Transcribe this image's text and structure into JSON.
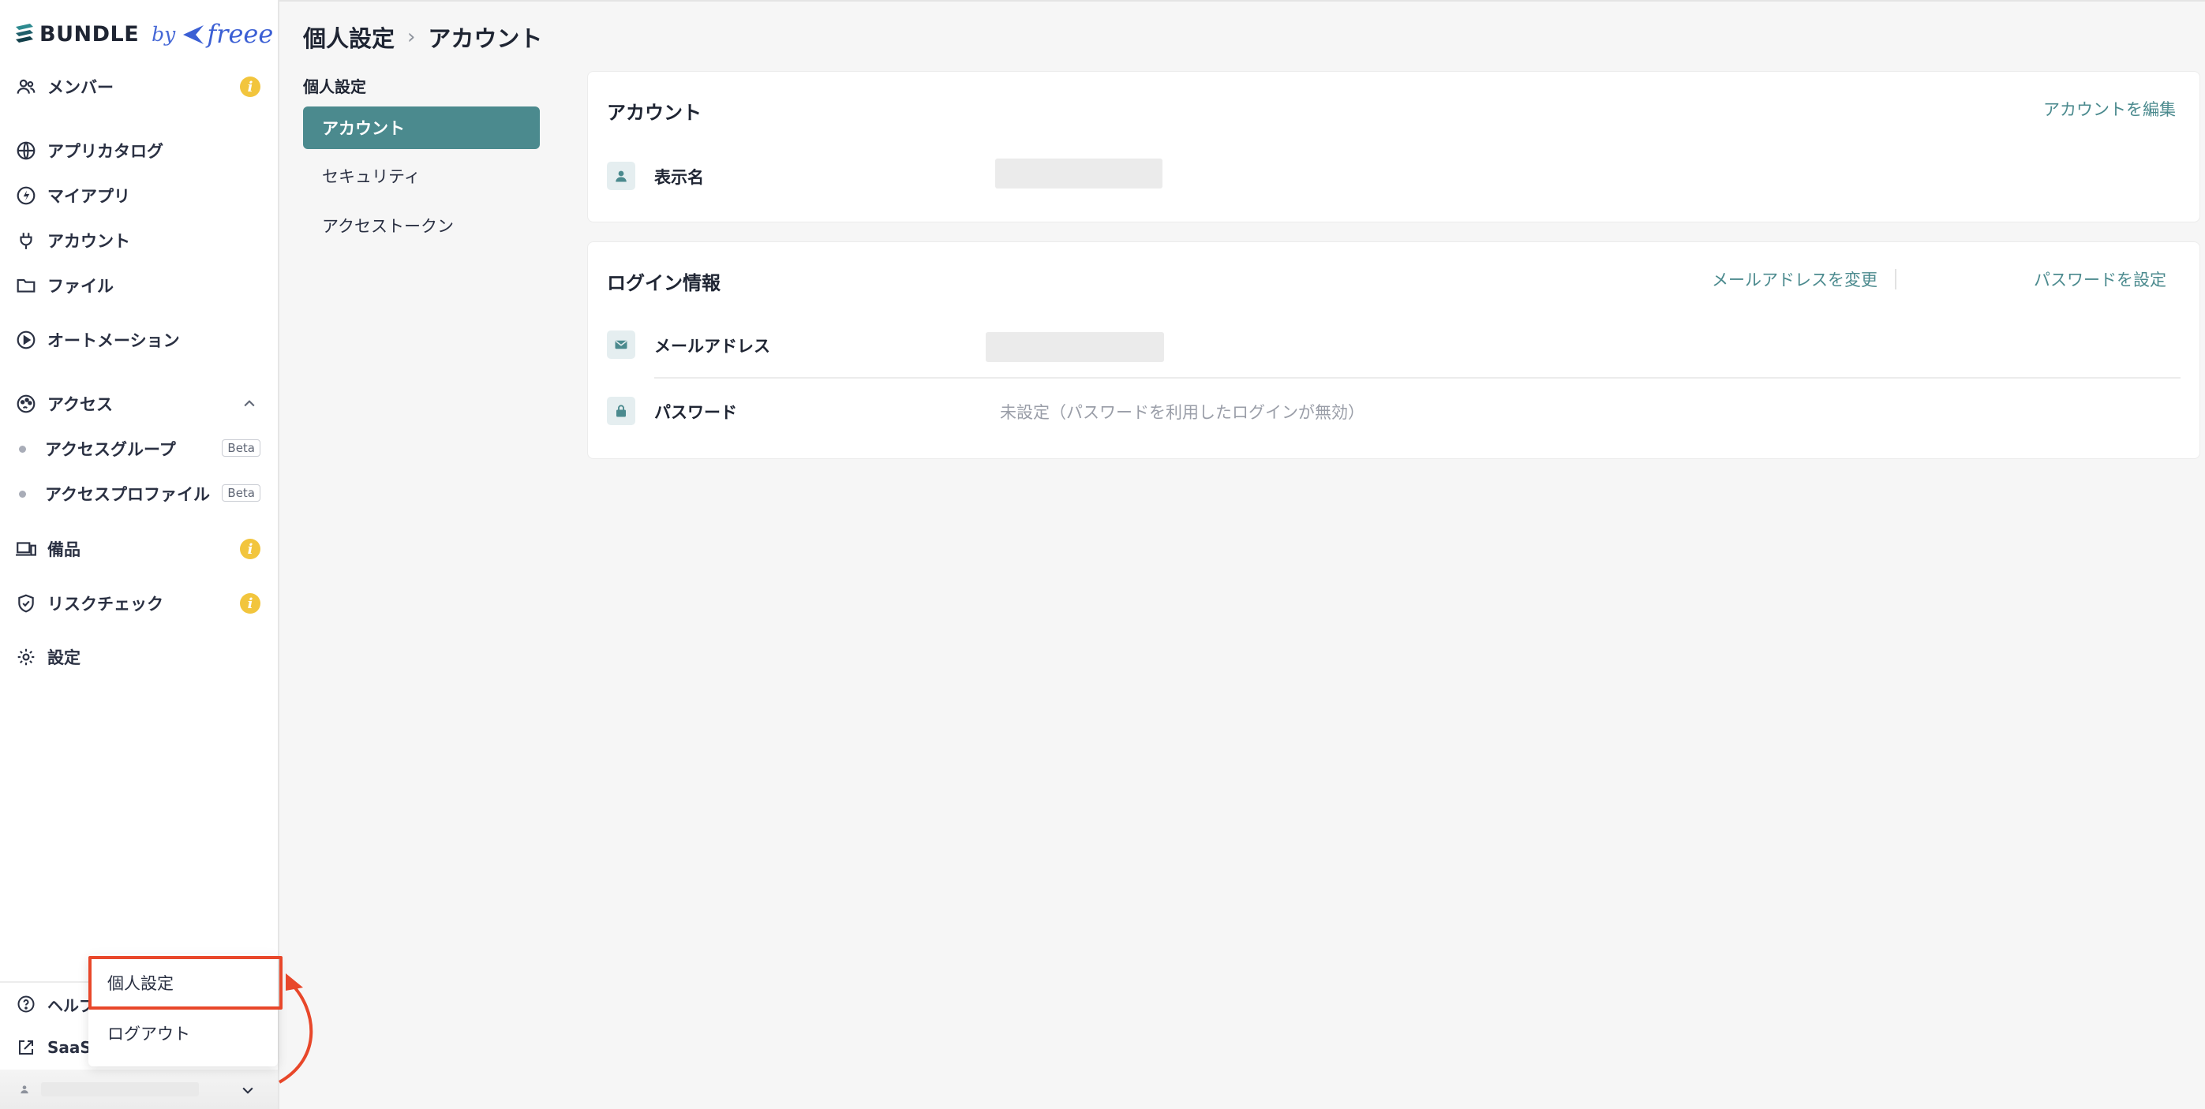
{
  "logo": {
    "brand": "BUNDLE",
    "by": "by",
    "partner": "freee"
  },
  "sidebar": {
    "items": [
      {
        "label": "メンバー",
        "icon": "users-icon",
        "badge": "i"
      },
      {
        "label": "アプリカタログ",
        "icon": "globe-icon"
      },
      {
        "label": "マイアプリ",
        "icon": "bolt-icon"
      },
      {
        "label": "アカウント",
        "icon": "plug-icon"
      },
      {
        "label": "ファイル",
        "icon": "folder-icon"
      },
      {
        "label": "オートメーション",
        "icon": "play-circle-icon"
      },
      {
        "label": "アクセス",
        "icon": "palette-icon"
      },
      {
        "label": "備品",
        "icon": "devices-icon",
        "badge": "i"
      },
      {
        "label": "リスクチェック",
        "icon": "shield-check-icon",
        "badge": "i"
      },
      {
        "label": "設定",
        "icon": "gear-icon"
      }
    ],
    "access_sub": [
      {
        "label": "アクセスグループ",
        "badge": "Beta"
      },
      {
        "label": "アクセスプロファイル",
        "badge": "Beta"
      }
    ],
    "footer": [
      {
        "label": "ヘルプ",
        "icon": "help-circle-icon"
      },
      {
        "label": "SaaS",
        "icon": "external-link-icon"
      }
    ]
  },
  "user_menu": {
    "items": [
      "個人設定",
      "ログアウト"
    ]
  },
  "breadcrumb": {
    "parent": "個人設定",
    "separator": "›",
    "current": "アカウント"
  },
  "subnav": {
    "title": "個人設定",
    "items": [
      "アカウント",
      "セキュリティ",
      "アクセストークン"
    ],
    "active": "アカウント"
  },
  "account_card": {
    "title": "アカウント",
    "edit_link": "アカウントを編集",
    "display_name_label": "表示名"
  },
  "login_card": {
    "title": "ログイン情報",
    "change_email_link": "メールアドレスを変更",
    "set_password_link": "パスワードを設定",
    "email_label": "メールアドレス",
    "password_label": "パスワード",
    "password_value": "未設定（パスワードを利用したログインが無効）"
  },
  "colors": {
    "accent": "#4b8a8e",
    "highlight": "#e8472a",
    "badge": "#f2c53d"
  }
}
